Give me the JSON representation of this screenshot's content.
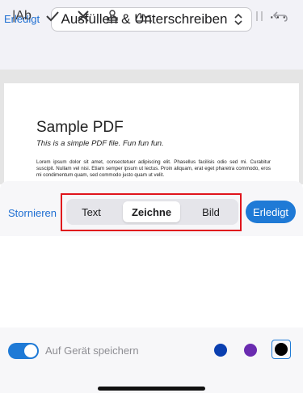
{
  "header": {
    "done_label": "Erledigt",
    "mode_title": "Ausfüllen & Unterschreiben",
    "more_label": "···"
  },
  "toolbar": {
    "text_tool_label": "|Ab",
    "icons": [
      "text-icon",
      "checkmark-icon",
      "cross-icon",
      "stamp-icon",
      "signature-icon",
      "pause-icon",
      "undo-icon"
    ]
  },
  "document": {
    "title": "Sample PDF",
    "subtitle": "This is a simple PDF file. Fun fun fun.",
    "body": "Lorem ipsum dolor sit amet, consectetuer adipiscing elit. Phasellus facilisis odio sed mi. Curabitur suscipit. Nullam vel nisi. Etiam semper ipsum ut lectus. Proin aliquam, erat eget pharetra commodo, eros mi condimentum quam, sed commodo justo quam ut velit."
  },
  "draw_panel": {
    "cancel_label": "Stornieren",
    "tabs": [
      {
        "label": "Text",
        "active": false
      },
      {
        "label": "Zeichne",
        "active": true
      },
      {
        "label": "Bild",
        "active": false
      }
    ],
    "done_label": "Erledigt"
  },
  "options": {
    "save_toggle_label": "Auf Gerät speichern",
    "save_toggle_on": true,
    "colors": [
      {
        "name": "blue",
        "hex": "#0a3fb0",
        "selected": false
      },
      {
        "name": "purple",
        "hex": "#6a2bb0",
        "selected": false
      },
      {
        "name": "black",
        "hex": "#000000",
        "selected": true
      }
    ]
  },
  "theme": {
    "accent": "#1f7ad6",
    "highlight": "#e0141c"
  }
}
